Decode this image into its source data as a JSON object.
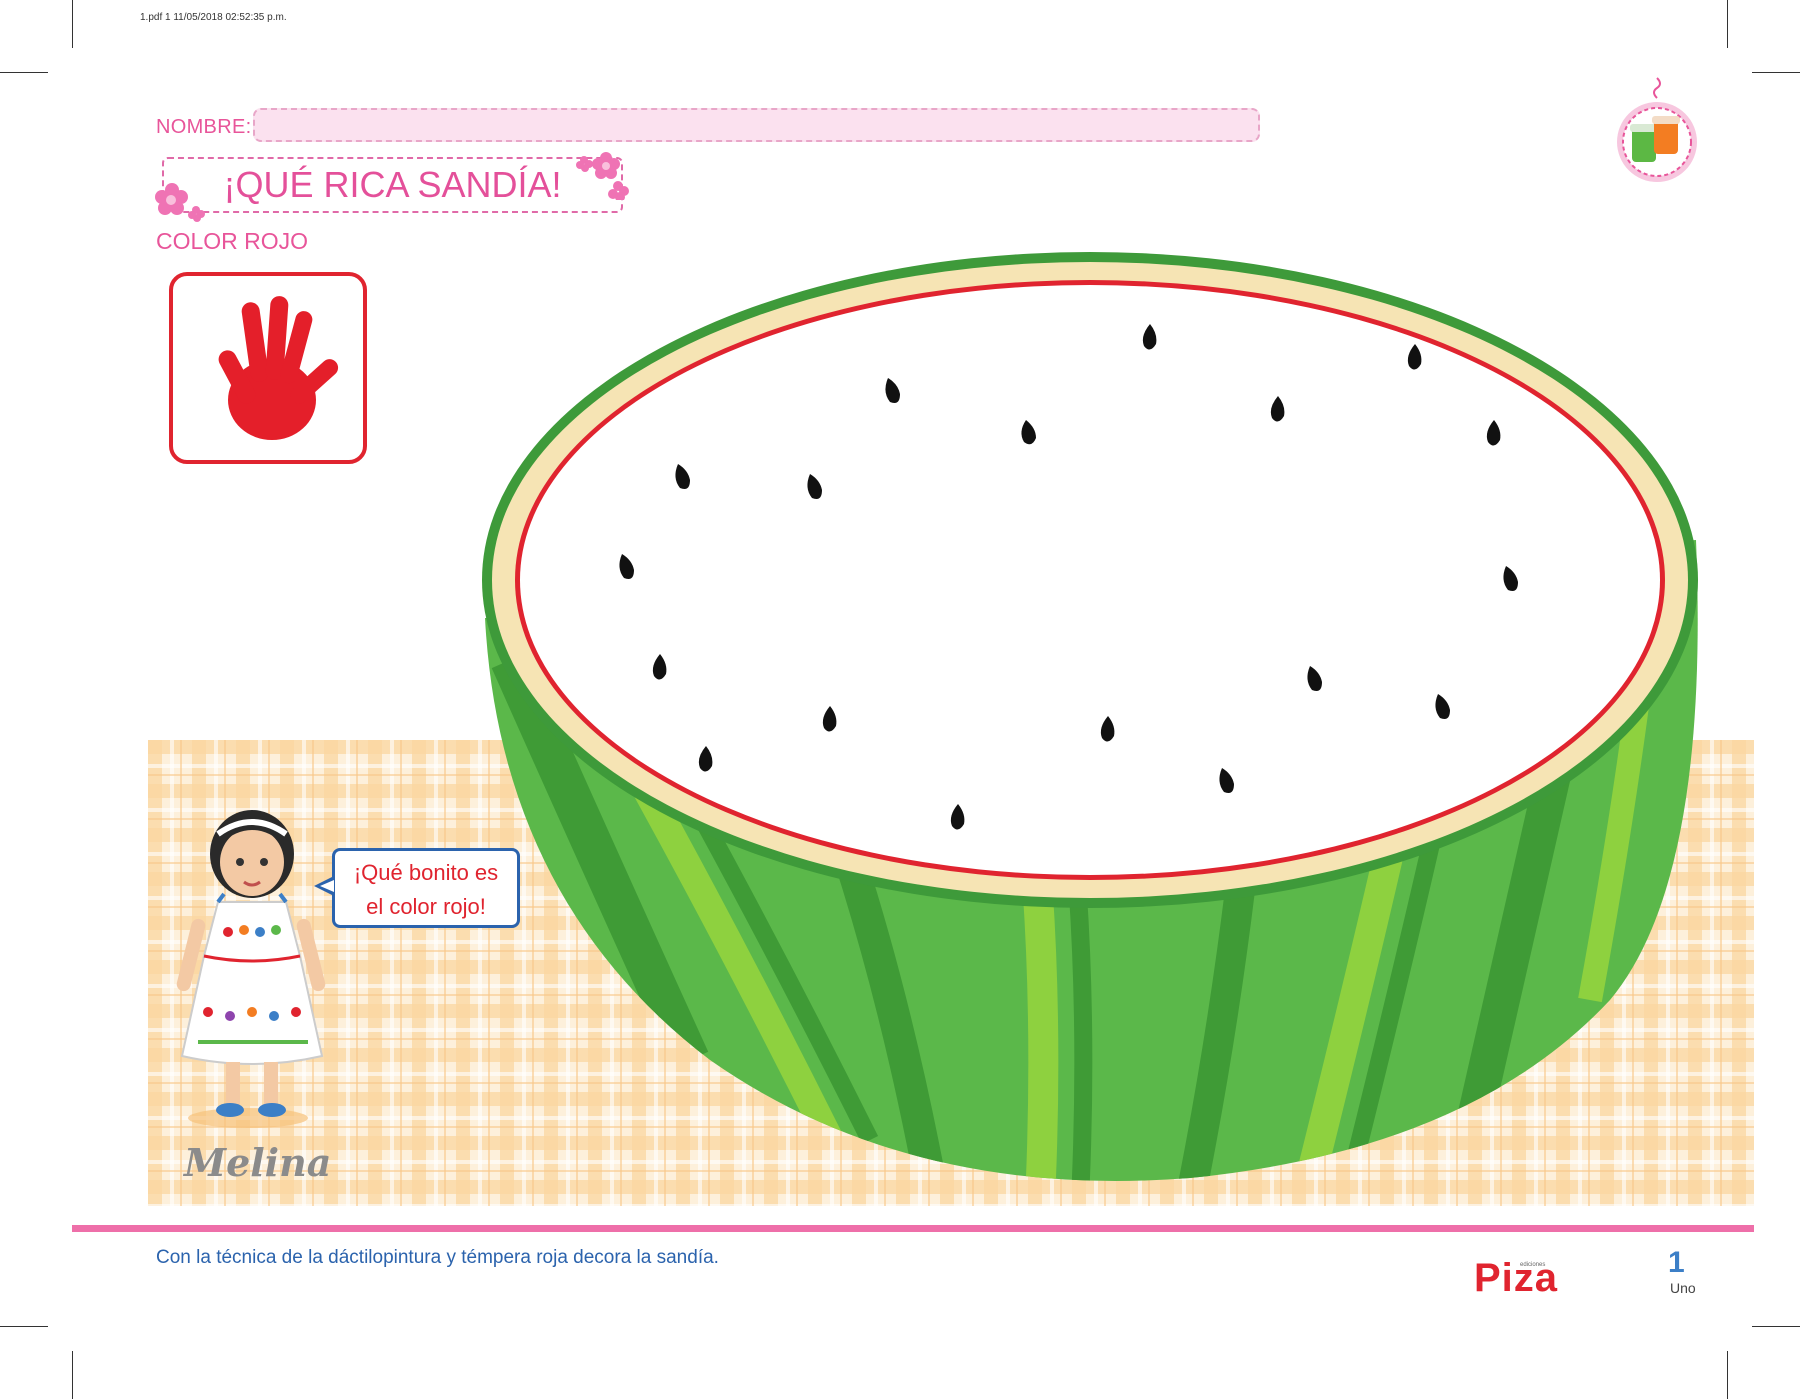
{
  "print_info": "1.pdf   1   11/05/2018   02:52:35 p.m.",
  "header": {
    "name_label": "NOMBRE:",
    "title": "¡QUÉ RICA SANDÍA!",
    "subtitle": "COLOR ROJO"
  },
  "illustration": {
    "hand_icon": "red-handprint-icon",
    "paint_jars_icon": "paint-jars-icon",
    "speech_bubble": {
      "line1": "¡Qué bonito es",
      "line2": "el color rojo!"
    },
    "character_name": "Melina",
    "colors": {
      "rind_dark": "#3e9a3a",
      "rind_light": "#8ed13f",
      "flesh_outline": "#e0242f",
      "cream": "#f6e4b4",
      "tablecloth": "#fbd8a4",
      "accent_pink": "#e8559a"
    }
  },
  "footer": {
    "instruction": "Con la técnica de la dáctilopintura y témpera roja decora la sandía.",
    "logo_small": "ediciones",
    "logo": "Piza",
    "page_number": "1",
    "page_word": "Uno"
  }
}
